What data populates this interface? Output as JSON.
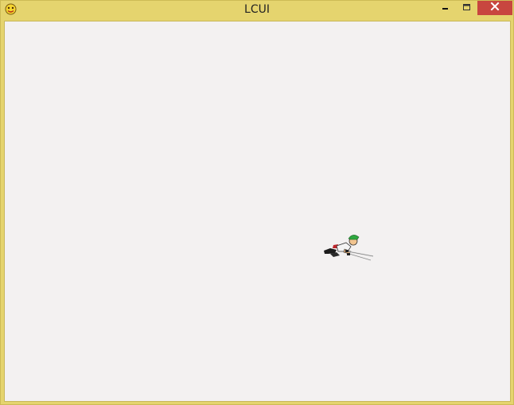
{
  "window": {
    "title": "LCUI",
    "app_icon": "lcui-app-icon",
    "controls": {
      "minimize_icon": "minimize-icon",
      "maximize_icon": "maximize-icon",
      "close_icon": "close-icon"
    },
    "colors": {
      "frame": "#e5d46e",
      "close_button": "#c8463f",
      "client_background": "#f3f1f1"
    }
  },
  "content": {
    "sprite": "character-sprite"
  }
}
